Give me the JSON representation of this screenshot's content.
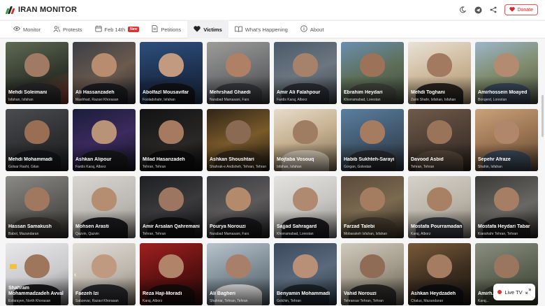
{
  "app": {
    "title": "IRAN MONITOR"
  },
  "header": {
    "donate_label": "Donate",
    "icons": [
      "theme-toggle-icon",
      "telegram-icon",
      "share-icon",
      "heart-icon"
    ]
  },
  "tabs": [
    {
      "label": "Monitor",
      "icon": "eye-icon"
    },
    {
      "label": "Protests",
      "icon": "people-icon"
    },
    {
      "label": "Feb 14th",
      "icon": "calendar-icon",
      "badge": "New"
    },
    {
      "label": "Petitions",
      "icon": "document-icon"
    },
    {
      "label": "Victims",
      "icon": "heart-icon",
      "active": true
    },
    {
      "label": "What's Happening",
      "icon": "book-icon"
    },
    {
      "label": "About",
      "icon": "info-icon"
    }
  ],
  "victims": [
    {
      "name": "Mehdi Soleimani",
      "location": "Isfahan, Isfahan"
    },
    {
      "name": "Ali Hassanzadeh",
      "location": "Mashhad, Razavi Khorasan"
    },
    {
      "name": "Abolfazl Mousavifar",
      "location": "Fooladshahr, Isfahan"
    },
    {
      "name": "Mehrshad Ghaedi",
      "location": "Nurabad Mamasani, Fars"
    },
    {
      "name": "Amir Ali Falahpour",
      "location": "Fardis Karaj, Alborz"
    },
    {
      "name": "Ebrahim Heydari",
      "location": "Khorramabad, Lorestan"
    },
    {
      "name": "Mehdi Toghani",
      "location": "Zarin Shahr, Isfahan, Isfahan"
    },
    {
      "name": "Amirhossein Moayed",
      "location": "Borujerd, Lorestan"
    },
    {
      "name": "Mehdi Mohammadi",
      "location": "Golsar Rasht, Gilan"
    },
    {
      "name": "Ashkan Alipour",
      "location": "Fardis Karaj, Alborz"
    },
    {
      "name": "Milad Hasanzadeh",
      "location": "Tehran, Tehran"
    },
    {
      "name": "Ashkan Shoushtari",
      "location": "Shahrak-e Andisheh, Tehran, Tehran"
    },
    {
      "name": "Mojtaba Vosouq",
      "location": "Isfahan, Isfahan"
    },
    {
      "name": "Habib Sukhteh-Sarayi",
      "location": "Gorgan, Golestan"
    },
    {
      "name": "Davood Asbid",
      "location": "Tehran, Tehran"
    },
    {
      "name": "Sepehr Afraze",
      "location": "Shahin, Isfahan"
    },
    {
      "name": "Hassan Samakush",
      "location": "Babol, Mazandaran"
    },
    {
      "name": "Mohsen Arasti",
      "location": "Qazvin, Qazvin"
    },
    {
      "name": "Amir Arsalan Qahremani",
      "location": "Tehran, Tehran"
    },
    {
      "name": "Pourya Norouzi",
      "location": "Nurabad Mamasani, Fars"
    },
    {
      "name": "Sajjad Sahragard",
      "location": "Khorramabad, Lorestan"
    },
    {
      "name": "Farzad Talebi",
      "location": "Mobarakeh Isfahan, Isfahan"
    },
    {
      "name": "Mostafa Pourramadan",
      "location": "Karaj, Alborz"
    },
    {
      "name": "Mostafa Heydari Tabar",
      "location": "Kianshahr Tehran, Tehran"
    },
    {
      "name": "Shahram Mohammadzadeh Avval",
      "location": "Esfarayen, North Khorasan"
    },
    {
      "name": "Faezeh Izi",
      "location": "Sabzevar, Razavi Khorasan"
    },
    {
      "name": "Reza Haji-Moradi",
      "location": "Karaj, Alborz"
    },
    {
      "name": "Ali Bagheri",
      "location": "Shahriar, Tehran, Tehran"
    },
    {
      "name": "Benyamin Mohammadi",
      "location": "Golchin, Tehran"
    },
    {
      "name": "Vahid Norouzi",
      "location": "Tehransar Tehran, Tehran"
    },
    {
      "name": "Ashkan Heydzadeh",
      "location": "Chalus, Mazandaran"
    },
    {
      "name": "Amirh...",
      "location": "Karaj..."
    }
  ],
  "live": {
    "label": "Live TV"
  },
  "colors": {
    "accent": "#e03131",
    "active_tab": "#f0f0f2"
  }
}
